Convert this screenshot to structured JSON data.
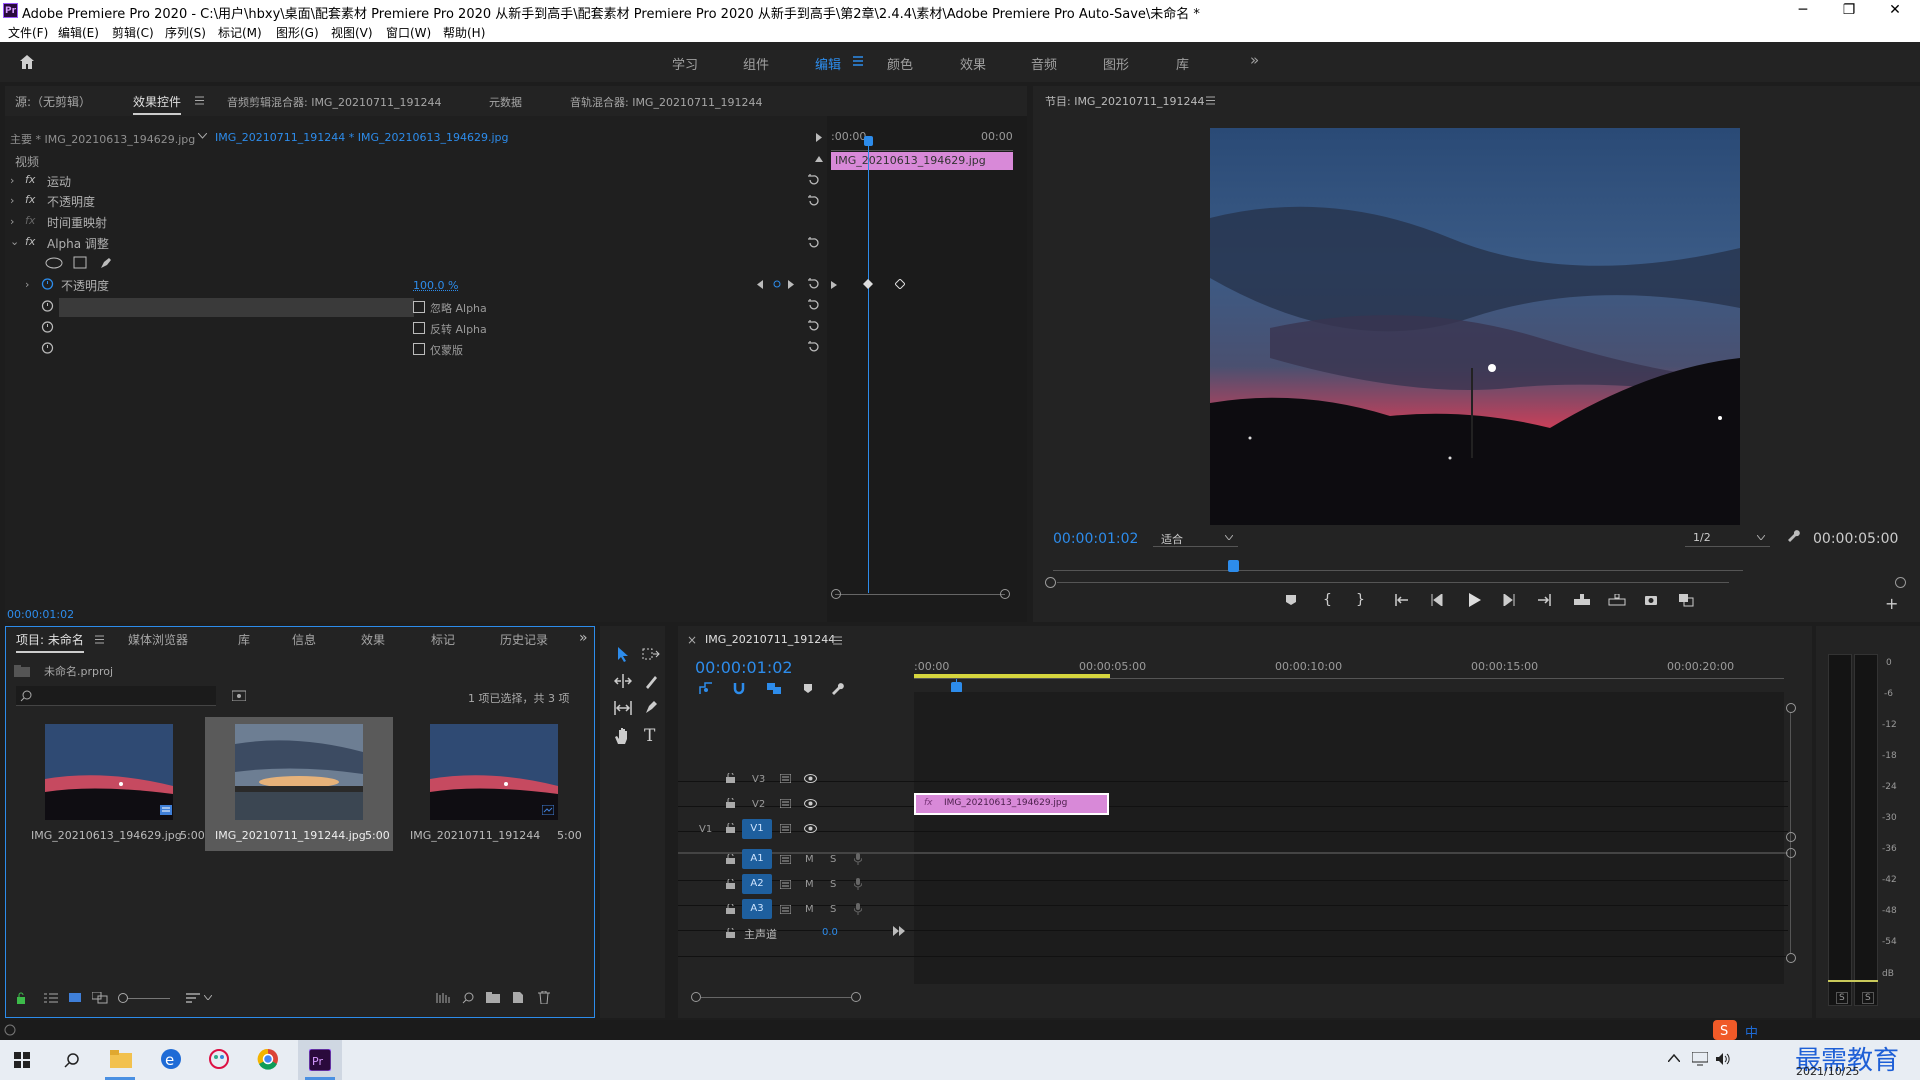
{
  "titlebar": {
    "title": "Adobe Premiere Pro 2020 - C:\\用户\\hbxy\\桌面\\配套素材 Premiere Pro 2020 从新手到高手\\配套素材 Premiere Pro 2020 从新手到高手\\第2章\\2.4.4\\素材\\Adobe Premiere Pro Auto-Save\\未命名 *",
    "app_badge": "Pr",
    "minimize": "─",
    "maximize": "❐",
    "close": "✕"
  },
  "menu": [
    "文件(F)",
    "编辑(E)",
    "剪辑(C)",
    "序列(S)",
    "标记(M)",
    "图形(G)",
    "视图(V)",
    "窗口(W)",
    "帮助(H)"
  ],
  "workspaces": [
    "学习",
    "组件",
    "编辑",
    "颜色",
    "效果",
    "音频",
    "图形",
    "库"
  ],
  "workspace_active": "编辑",
  "workspace_more": "»",
  "source_tabs": [
    "源:（无剪辑）",
    "效果控件",
    "音频剪辑混合器: IMG_20210711_191244",
    "元数据",
    "音轨混合器: IMG_20210711_191244"
  ],
  "effect_controls": {
    "master": "主要 * IMG_20210613_194629.jpg",
    "clip": "IMG_20210711_191244 * IMG_20210613_194629.jpg",
    "tc_start": ":00:00",
    "tc_end": "00:00",
    "clip_bar": "IMG_20210613_194629.jpg",
    "section": "视频",
    "effects": [
      "运动",
      "不透明度",
      "时间重映射",
      "Alpha 调整"
    ],
    "opacity_label": "不透明度",
    "opacity_value": "100.0 %",
    "check_labels": [
      "忽略 Alpha",
      "反转 Alpha",
      "仅蒙版"
    ],
    "timecode": "00:00:01:02"
  },
  "program": {
    "title": "节目: IMG_20210711_191244",
    "timecode": "00:00:01:02",
    "fit": "适合",
    "resolution": "1/2",
    "duration": "00:00:05:00"
  },
  "project": {
    "tabs": [
      "项目: 未命名",
      "媒体浏览器",
      "库",
      "信息",
      "效果",
      "标记",
      "历史记录"
    ],
    "file": "未命名.prproj",
    "selection_info": "1 项已选择，共 3 项",
    "items": [
      {
        "name": "IMG_20210613_194629.jpg",
        "duration": "5:00"
      },
      {
        "name": "IMG_20210711_191244.jpg",
        "duration": "5:00"
      },
      {
        "name": "IMG_20210711_191244",
        "duration": "5:00"
      }
    ]
  },
  "timeline": {
    "seq_name": "IMG_20210711_191244",
    "close": "×",
    "timecode": "00:00:01:02",
    "ruler": [
      ":00:00",
      "00:00:05:00",
      "00:00:10:00",
      "00:00:15:00",
      "00:00:20:00"
    ],
    "video_tracks": [
      "V3",
      "V2",
      "V1"
    ],
    "audio_tracks": [
      "A1",
      "A2",
      "A3"
    ],
    "src_patch": "V1",
    "clip_name": "IMG_20210613_194629.jpg",
    "clip_fx": "fx",
    "master_label": "主声道",
    "master_value": "0.0",
    "mute": "M",
    "solo": "S"
  },
  "meter": {
    "scale": [
      "0",
      "-6",
      "-12",
      "-18",
      "-24",
      "-30",
      "-36",
      "-42",
      "-48",
      "-54",
      "dB"
    ],
    "solo": [
      "S",
      "S"
    ]
  },
  "taskbar": {
    "date": "2021/10/25",
    "watermark": "最需教育",
    "ime": "中"
  }
}
